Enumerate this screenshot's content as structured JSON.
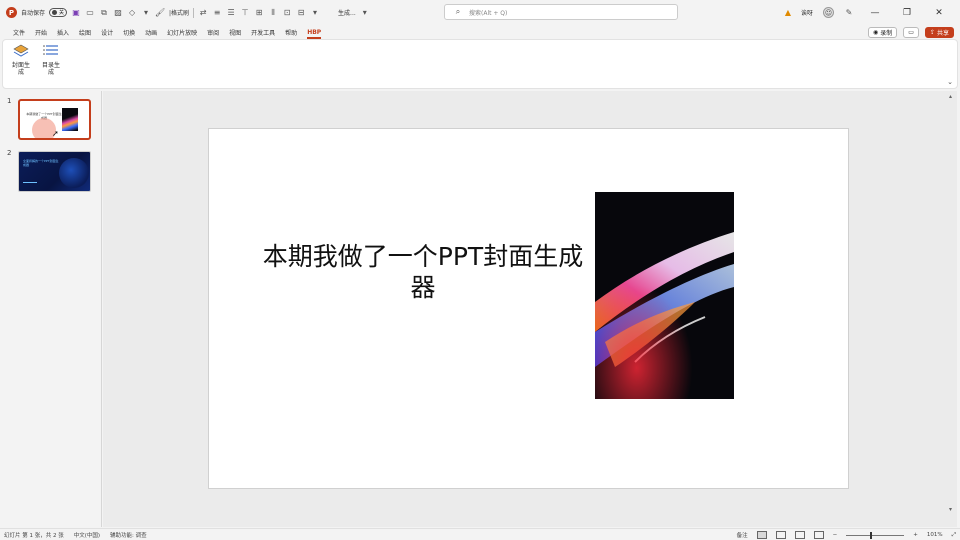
{
  "titlebar": {
    "autosave_label": "自动保存",
    "autosave_state": "关",
    "format_painter_label": "|格式刷",
    "mode_label": "生成...",
    "search_placeholder": "搜索(Alt + Q)",
    "user_name": "诶呀",
    "share_label": "共享",
    "record_label": "录制"
  },
  "ribbon_tabs": [
    "文件",
    "开始",
    "插入",
    "绘图",
    "设计",
    "切换",
    "动画",
    "幻灯片放映",
    "审阅",
    "视图",
    "开发工具",
    "帮助",
    "HBP"
  ],
  "active_tab": "HBP",
  "ribbon_buttons": [
    {
      "label": "封面生成",
      "icon": "layers-icon"
    },
    {
      "label": "目录生成",
      "icon": "list-icon"
    }
  ],
  "slides": [
    {
      "number": "1",
      "thumb_title": "本期我做了一个PPT封面生成器"
    },
    {
      "number": "2",
      "thumb_title": "全面拆解的一个PPT封面生成器"
    }
  ],
  "slide": {
    "title": "本期我做了一个PPT封面生成器"
  },
  "statusbar": {
    "slide_pos": "幻灯片 第 1 张，共 2 张",
    "language": "中文(中国)",
    "accessibility": "辅助功能: 调查",
    "notes_label": "备注",
    "zoom": "101%"
  },
  "colors": {
    "accent": "#c43e1c",
    "thumb2_bg": "#0b1d59",
    "thumb2_text": "#6ec1ff"
  }
}
